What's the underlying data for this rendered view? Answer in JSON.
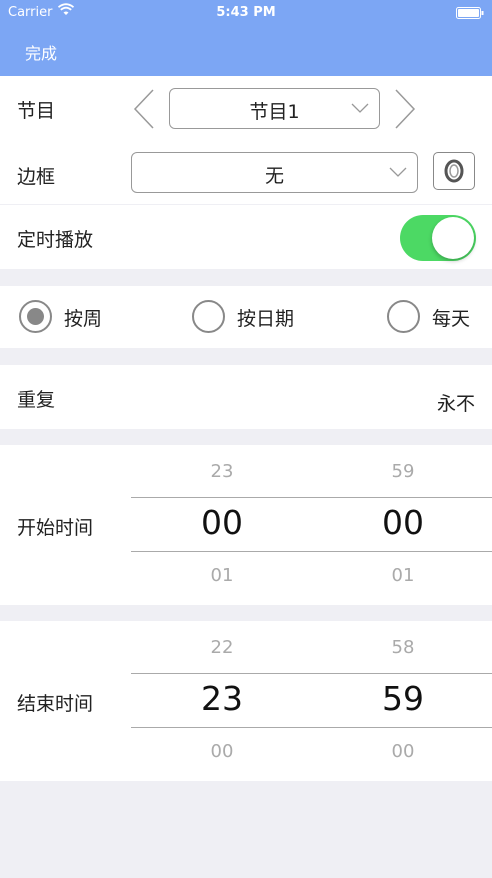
{
  "status_bar": {
    "carrier": "Carrier",
    "time": "5:43 PM"
  },
  "nav": {
    "done_label": "完成"
  },
  "program": {
    "label": "节目",
    "value": "节目1"
  },
  "border": {
    "label": "边框",
    "value": "无"
  },
  "timer_play": {
    "label": "定时播放",
    "enabled": true
  },
  "mode": {
    "options": [
      {
        "label": "按周",
        "selected": true
      },
      {
        "label": "按日期",
        "selected": false
      },
      {
        "label": "每天",
        "selected": false
      }
    ]
  },
  "repeat": {
    "label": "重复",
    "value": "永不"
  },
  "start_time": {
    "label": "开始时间",
    "hours": {
      "prev": "23",
      "current": "00",
      "next": "01"
    },
    "minutes": {
      "prev": "59",
      "current": "00",
      "next": "01"
    }
  },
  "end_time": {
    "label": "结束时间",
    "hours": {
      "prev": "22",
      "current": "23",
      "next": "00"
    },
    "minutes": {
      "prev": "58",
      "current": "59",
      "next": "00"
    }
  },
  "colors": {
    "nav": "#7ca6f4",
    "toggle_on": "#4cd964",
    "background": "#efeff4"
  }
}
